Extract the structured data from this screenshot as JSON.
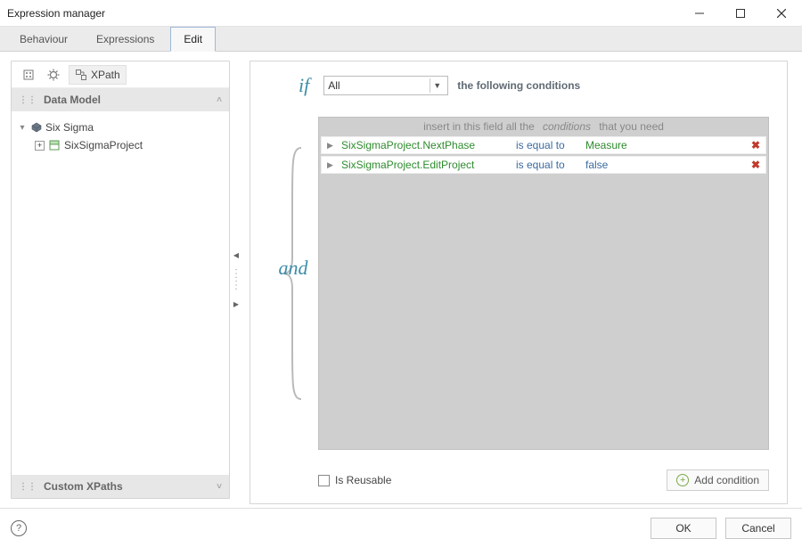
{
  "window": {
    "title": "Expression manager"
  },
  "tabs": [
    "Behaviour",
    "Expressions",
    "Edit"
  ],
  "activeTab": "Edit",
  "leftToolbar": {
    "xpath_label": "XPath"
  },
  "sidebar": {
    "dataModel": {
      "title": "Data Model"
    },
    "tree": {
      "root": "Six Sigma",
      "child": "SixSigmaProject"
    },
    "customXPaths": {
      "title": "Custom XPaths"
    }
  },
  "editor": {
    "if_kw": "if",
    "quantifier": "All",
    "afterText": "the following conditions",
    "hint_pre": "insert in this field all the",
    "hint_mid": "conditions",
    "hint_post": "that you need",
    "and_kw": "and",
    "rows": [
      {
        "field": "SixSigmaProject.NextPhase",
        "op": "is equal to",
        "val": "Measure",
        "valStyle": "g"
      },
      {
        "field": "SixSigmaProject.EditProject",
        "op": "is equal to",
        "val": "false",
        "valStyle": "b"
      }
    ],
    "reusable_label": "Is Reusable",
    "add_label": "Add condition"
  },
  "footer": {
    "ok": "OK",
    "cancel": "Cancel"
  }
}
